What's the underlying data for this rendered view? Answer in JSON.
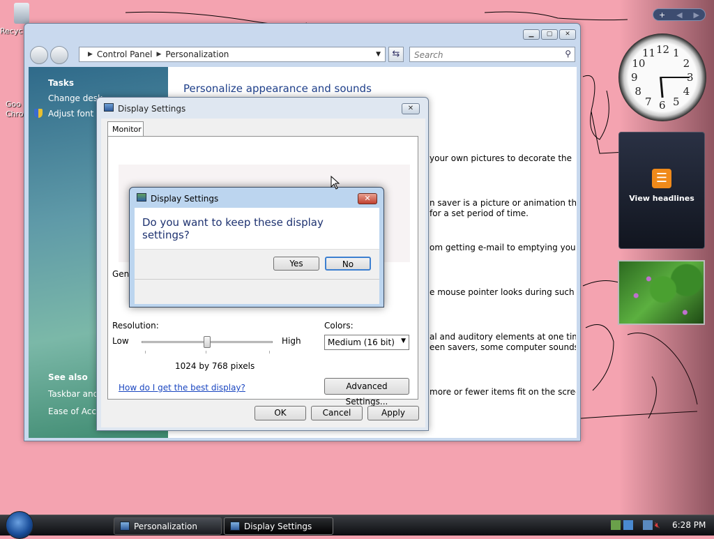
{
  "desktop": {
    "icon_recycle": "Recyc",
    "icon_chrome_1": "Goo",
    "icon_chrome_2": "Chro"
  },
  "sidebar": {
    "controls": [
      "+",
      "◀",
      "▶"
    ],
    "rss_label": "View headlines",
    "clock_numbers": [
      "12",
      "1",
      "2",
      "3",
      "4",
      "5",
      "6",
      "7",
      "8",
      "9",
      "10",
      "11"
    ]
  },
  "control_panel": {
    "breadcrumb": [
      "Control Panel",
      "Personalization"
    ],
    "search_placeholder": "Search",
    "left": {
      "tasks_heading": "Tasks",
      "task_links": [
        "Change desk",
        "Adjust font si"
      ],
      "see_also_heading": "See also",
      "see_also_links": [
        "Taskbar and S",
        "Ease of Acces"
      ]
    },
    "heading": "Personalize appearance and sounds",
    "descriptions": [
      [
        "your own pictures to decorate the"
      ],
      [
        "n saver is a picture or animation that",
        "for a set period of time."
      ],
      [
        "om getting e-mail to emptying your"
      ],
      [
        "e mouse pointer looks during such"
      ],
      [
        "al and auditory elements at one time",
        "een savers, some computer sounds,"
      ],
      [
        "more or fewer items fit on the screen."
      ]
    ]
  },
  "display_settings": {
    "title": "Display Settings",
    "tab": "Monitor",
    "general_label": "Gen",
    "resolution_label": "Resolution:",
    "low": "Low",
    "high": "High",
    "resolution_value": "1024 by 768 pixels",
    "resolution_level": 0.5,
    "colors_label": "Colors:",
    "colors_value": "Medium (16 bit)",
    "help_link": "How do I get the best display?",
    "advanced_button": "Advanced Settings...",
    "ok": "OK",
    "cancel": "Cancel",
    "apply": "Apply"
  },
  "confirm": {
    "title": "Display Settings",
    "question": "Do you want to keep these display settings?",
    "yes": "Yes",
    "no": "No"
  },
  "taskbar": {
    "tasks": [
      "Personalization",
      "Display Settings"
    ],
    "time": "6:28 PM"
  }
}
